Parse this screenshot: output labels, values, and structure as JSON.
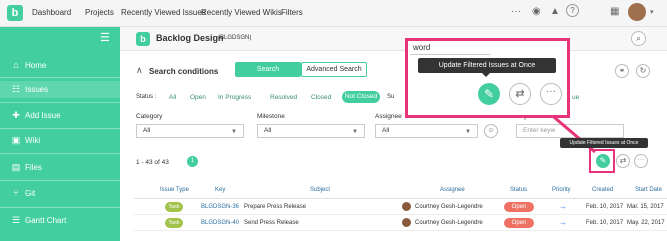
{
  "topnav": {
    "logo": "b",
    "links": [
      "Dashboard",
      "Projects",
      "Recently Viewed Issues",
      "Recently Viewed Wikis",
      "Filters"
    ]
  },
  "sidebar": {
    "items": [
      {
        "label": "Home",
        "icon": "home-icon"
      },
      {
        "label": "Issues",
        "icon": "list-icon"
      },
      {
        "label": "Add Issue",
        "icon": "plus-icon"
      },
      {
        "label": "Wiki",
        "icon": "wiki-icon"
      },
      {
        "label": "Files",
        "icon": "file-icon"
      },
      {
        "label": "Git",
        "icon": "git-icon"
      },
      {
        "label": "Gantt Chart",
        "icon": "gantt-icon"
      }
    ],
    "active": "Issues"
  },
  "project": {
    "badge": "b",
    "name": "Backlog Design",
    "key": "(BLGDSGN)"
  },
  "search": {
    "title": "Search conditions",
    "tab_search": "Search",
    "tab_advanced": "Advanced Search",
    "status_label": "Status :",
    "statuses": [
      "All",
      "Open",
      "In Progress",
      "Resolved",
      "Closed",
      "Not Closed"
    ],
    "status_selected": "Not Closed",
    "status_trunc_1": "Su",
    "status_trunc_2": "ue",
    "filters": [
      {
        "label": "Category",
        "value": "All"
      },
      {
        "label": "Milestone",
        "value": "All"
      },
      {
        "label": "Assignee",
        "value": "All"
      }
    ],
    "keyword_label": "Keyw",
    "keyword_placeholder": "Enter keyw"
  },
  "results": {
    "count": "1 - 43 of 43",
    "badge": "1"
  },
  "table": {
    "headers": [
      "Issue Type",
      "Key",
      "Subject",
      "Assignee",
      "Status",
      "Priority",
      "Created",
      "Start Date"
    ],
    "rows": [
      {
        "type": "Task",
        "key": "BLGDSGN-36",
        "subject": "Prepare Press Release",
        "assignee": "Courtney Gesh-Legendre",
        "status": "Open",
        "created": "Feb. 10, 2017",
        "start": "Mar. 15, 2017"
      },
      {
        "type": "Task",
        "key": "BLGDSGN-40",
        "subject": "Send Press Release",
        "assignee": "Courtney Gesh-Legendre",
        "status": "Open",
        "created": "Feb. 10, 2017",
        "start": "May. 22, 2017"
      }
    ]
  },
  "callout": {
    "tooltip": "Update Filtered Issues at Once",
    "small_tooltip": "Update Filtered Issues at Once",
    "partial_text": "word"
  },
  "colors": {
    "brand": "#42ce9f",
    "highlight": "#e7337a",
    "open": "#ee7163",
    "task": "#a1c24b"
  }
}
